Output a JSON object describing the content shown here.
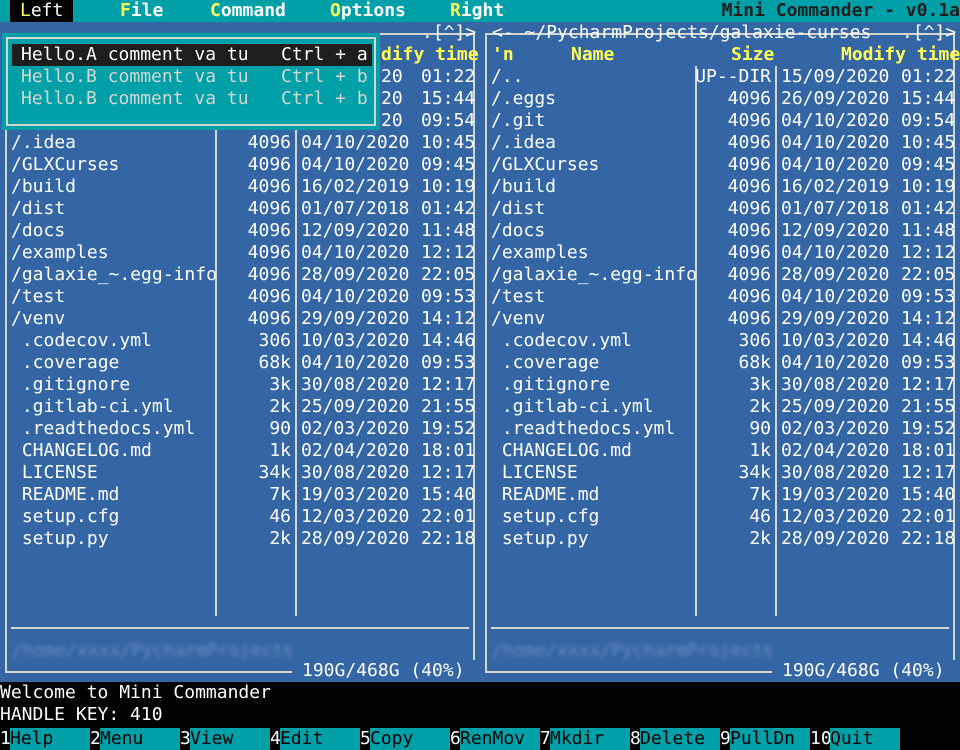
{
  "app_title": "Mini Commander - v0.1a",
  "menu": [
    {
      "hot": "L",
      "rest": "eft",
      "selected": true
    },
    {
      "hot": "F",
      "rest": "ile",
      "selected": false
    },
    {
      "hot": "C",
      "rest": "ommand",
      "selected": false
    },
    {
      "hot": "O",
      "rest": "ptions",
      "selected": false
    },
    {
      "hot": "R",
      "rest": "ight",
      "selected": false
    }
  ],
  "dropdown": [
    {
      "label": "Hello.A comment va tu",
      "shortcut": "Ctrl + a",
      "active": true
    },
    {
      "label": "Hello.B comment va tu",
      "shortcut": "Ctrl + b",
      "active": false
    },
    {
      "label": "Hello.B comment va tu",
      "shortcut": "Ctrl + b",
      "active": false
    }
  ],
  "left_panel": {
    "top_right_marker": ".[^]>",
    "header_modify": "dify time",
    "partial_rows": [
      {
        "date": "20",
        "time": "01:22"
      },
      {
        "date": "20",
        "time": "15:44"
      },
      {
        "date": "20",
        "time": "09:54"
      }
    ],
    "rows": [
      {
        "name": "/.idea",
        "size": "4096",
        "date": "04/10/2020",
        "time": "10:45"
      },
      {
        "name": "/GLXCurses",
        "size": "4096",
        "date": "04/10/2020",
        "time": "09:45"
      },
      {
        "name": "/build",
        "size": "4096",
        "date": "16/02/2019",
        "time": "10:19"
      },
      {
        "name": "/dist",
        "size": "4096",
        "date": "01/07/2018",
        "time": "01:42"
      },
      {
        "name": "/docs",
        "size": "4096",
        "date": "12/09/2020",
        "time": "11:48"
      },
      {
        "name": "/examples",
        "size": "4096",
        "date": "04/10/2020",
        "time": "12:12"
      },
      {
        "name": "/galaxie_~.egg-info",
        "size": "4096",
        "date": "28/09/2020",
        "time": "22:05"
      },
      {
        "name": "/test",
        "size": "4096",
        "date": "04/10/2020",
        "time": "09:53"
      },
      {
        "name": "/venv",
        "size": "4096",
        "date": "29/09/2020",
        "time": "14:12"
      },
      {
        "name": " .codecov.yml",
        "size": "306",
        "date": "10/03/2020",
        "time": "14:46"
      },
      {
        "name": " .coverage",
        "size": "68k",
        "date": "04/10/2020",
        "time": "09:53"
      },
      {
        "name": " .gitignore",
        "size": "3k",
        "date": "30/08/2020",
        "time": "12:17"
      },
      {
        "name": " .gitlab-ci.yml",
        "size": "2k",
        "date": "25/09/2020",
        "time": "21:55"
      },
      {
        "name": " .readthedocs.yml",
        "size": "90",
        "date": "02/03/2020",
        "time": "19:52"
      },
      {
        "name": " CHANGELOG.md",
        "size": "1k",
        "date": "02/04/2020",
        "time": "18:01"
      },
      {
        "name": " LICENSE",
        "size": "34k",
        "date": "30/08/2020",
        "time": "12:17"
      },
      {
        "name": " README.md",
        "size": "7k",
        "date": "19/03/2020",
        "time": "15:40"
      },
      {
        "name": " setup.cfg",
        "size": "46",
        "date": "12/03/2020",
        "time": "22:01"
      },
      {
        "name": " setup.py",
        "size": "2k",
        "date": "28/09/2020",
        "time": "22:18"
      }
    ],
    "mini_status": "/home/xxxx/PycharmProjects",
    "disk": "190G/468G (40%)"
  },
  "right_panel": {
    "path": "<- ~/PycharmProjects/galaxie-curses",
    "top_right_marker": ".[^]>",
    "headers": {
      "sort": "'n",
      "name": "Name",
      "size": "Size",
      "modify": "Modify time"
    },
    "rows": [
      {
        "name": "/..",
        "size": "UP--DIR",
        "date": "15/09/2020",
        "time": "01:22"
      },
      {
        "name": "/.eggs",
        "size": "4096",
        "date": "26/09/2020",
        "time": "15:44"
      },
      {
        "name": "/.git",
        "size": "4096",
        "date": "04/10/2020",
        "time": "09:54"
      },
      {
        "name": "/.idea",
        "size": "4096",
        "date": "04/10/2020",
        "time": "10:45"
      },
      {
        "name": "/GLXCurses",
        "size": "4096",
        "date": "04/10/2020",
        "time": "09:45"
      },
      {
        "name": "/build",
        "size": "4096",
        "date": "16/02/2019",
        "time": "10:19"
      },
      {
        "name": "/dist",
        "size": "4096",
        "date": "01/07/2018",
        "time": "01:42"
      },
      {
        "name": "/docs",
        "size": "4096",
        "date": "12/09/2020",
        "time": "11:48"
      },
      {
        "name": "/examples",
        "size": "4096",
        "date": "04/10/2020",
        "time": "12:12"
      },
      {
        "name": "/galaxie_~.egg-info",
        "size": "4096",
        "date": "28/09/2020",
        "time": "22:05"
      },
      {
        "name": "/test",
        "size": "4096",
        "date": "04/10/2020",
        "time": "09:53"
      },
      {
        "name": "/venv",
        "size": "4096",
        "date": "29/09/2020",
        "time": "14:12"
      },
      {
        "name": " .codecov.yml",
        "size": "306",
        "date": "10/03/2020",
        "time": "14:46"
      },
      {
        "name": " .coverage",
        "size": "68k",
        "date": "04/10/2020",
        "time": "09:53"
      },
      {
        "name": " .gitignore",
        "size": "3k",
        "date": "30/08/2020",
        "time": "12:17"
      },
      {
        "name": " .gitlab-ci.yml",
        "size": "2k",
        "date": "25/09/2020",
        "time": "21:55"
      },
      {
        "name": " .readthedocs.yml",
        "size": "90",
        "date": "02/03/2020",
        "time": "19:52"
      },
      {
        "name": " CHANGELOG.md",
        "size": "1k",
        "date": "02/04/2020",
        "time": "18:01"
      },
      {
        "name": " LICENSE",
        "size": "34k",
        "date": "30/08/2020",
        "time": "12:17"
      },
      {
        "name": " README.md",
        "size": "7k",
        "date": "19/03/2020",
        "time": "15:40"
      },
      {
        "name": " setup.cfg",
        "size": "46",
        "date": "12/03/2020",
        "time": "22:01"
      },
      {
        "name": " setup.py",
        "size": "2k",
        "date": "28/09/2020",
        "time": "22:18"
      }
    ],
    "mini_status": "/home/xxxx/PycharmProjects",
    "disk": "190G/468G (40%)"
  },
  "status_lines": [
    "Welcome to Mini Commander",
    "HANDLE KEY: 410"
  ],
  "fkeys": [
    {
      "num": "1",
      "label": "Help"
    },
    {
      "num": "2",
      "label": "Menu"
    },
    {
      "num": "3",
      "label": "View"
    },
    {
      "num": "4",
      "label": "Edit"
    },
    {
      "num": "5",
      "label": "Copy"
    },
    {
      "num": "6",
      "label": "RenMov"
    },
    {
      "num": "7",
      "label": "Mkdir"
    },
    {
      "num": "8",
      "label": "Delete"
    },
    {
      "num": "9",
      "label": "PullDn"
    },
    {
      "num": "10",
      "label": "Quit"
    }
  ],
  "colors": {
    "panel": "#3465a4",
    "cyan": "#00a0a8",
    "header": "#ffff55"
  }
}
